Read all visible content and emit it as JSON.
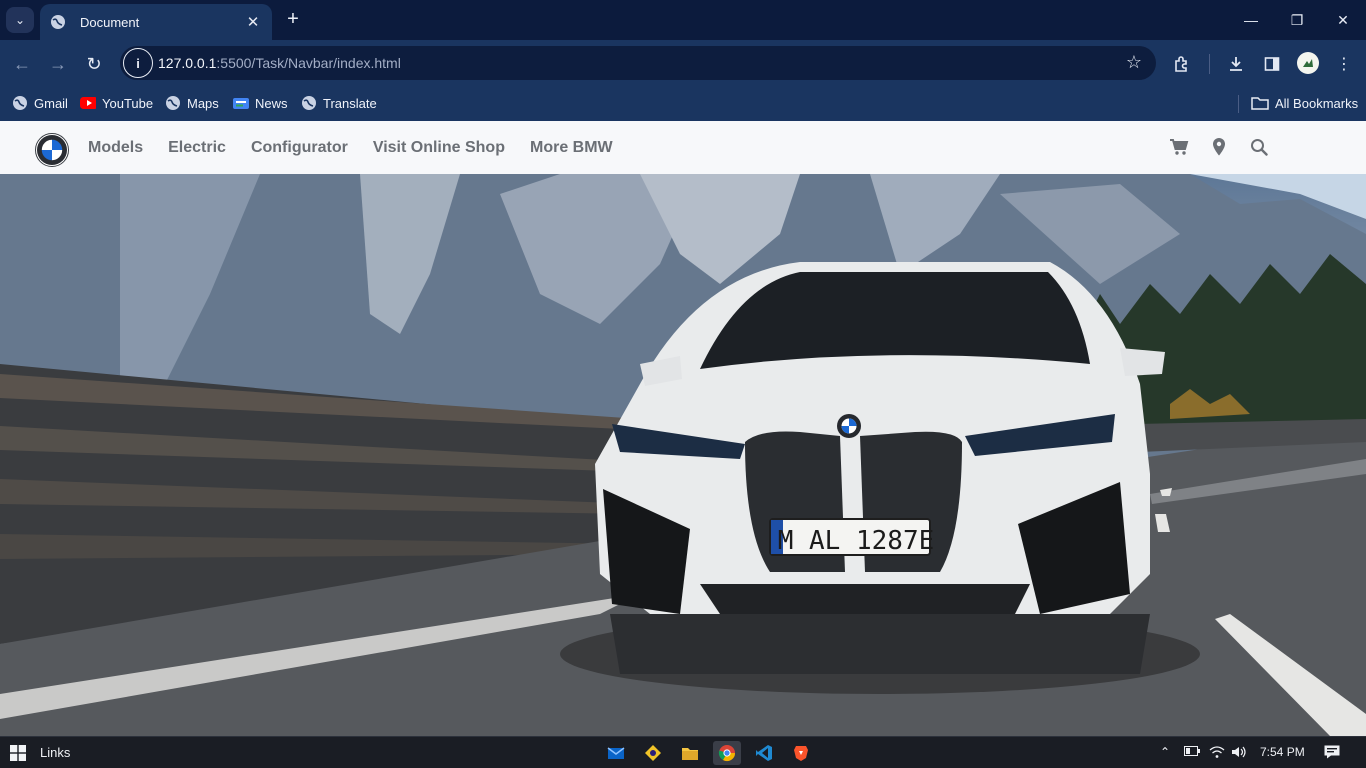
{
  "browser": {
    "tab": {
      "title": "Document",
      "close": "✕"
    },
    "new_tab": "+",
    "url_host": "127.0.0.1",
    "url_rest": ":5500/Task/Navbar/index.html",
    "window_controls": {
      "minimize": "—",
      "restore": "❐",
      "close": "✕"
    }
  },
  "bookmarks": [
    {
      "label": "Gmail",
      "icon": "globe-icon"
    },
    {
      "label": "YouTube",
      "icon": "youtube-icon"
    },
    {
      "label": "Maps",
      "icon": "globe-icon"
    },
    {
      "label": "News",
      "icon": "news-icon"
    },
    {
      "label": "Translate",
      "icon": "globe-icon"
    }
  ],
  "all_bookmarks": "All Bookmarks",
  "site": {
    "nav_links": [
      "Models",
      "Electric",
      "Configurator",
      "Visit Online Shop",
      "More BMW"
    ],
    "icons": [
      "cart-icon",
      "location-pin-icon",
      "search-icon"
    ],
    "license_plate": "M AL 1287E"
  },
  "taskbar": {
    "links_label": "Links",
    "time": "7:54 PM"
  },
  "colors": {
    "chrome_dark": "#0c1b3d",
    "chrome": "#1a3560",
    "nav_bg": "#f7f8fa",
    "nav_text": "#6b6f75",
    "bmw_blue": "#1c69d4"
  }
}
